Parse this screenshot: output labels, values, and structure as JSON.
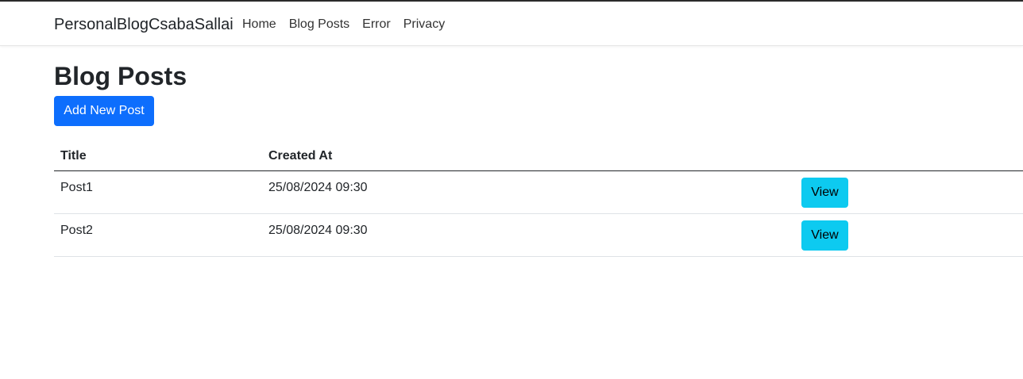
{
  "navbar": {
    "brand": "PersonalBlogCsabaSallai",
    "links": [
      "Home",
      "Blog Posts",
      "Error",
      "Privacy"
    ]
  },
  "page": {
    "title": "Blog Posts",
    "add_button": "Add New Post"
  },
  "table": {
    "headers": [
      "Title",
      "Created At",
      ""
    ],
    "rows": [
      {
        "title": "Post1",
        "created_at": "25/08/2024 09:30",
        "action": "View"
      },
      {
        "title": "Post2",
        "created_at": "25/08/2024 09:30",
        "action": "View"
      }
    ]
  },
  "colors": {
    "primary": "#0d6efd",
    "info": "#0dcaf0",
    "text": "#212529"
  }
}
